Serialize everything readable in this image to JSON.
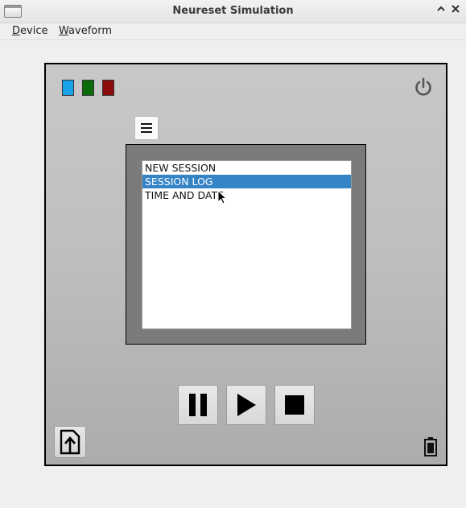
{
  "window": {
    "title": "Neureset Simulation",
    "buttons": [
      "chevron-up-icon",
      "close-icon"
    ]
  },
  "menubar": {
    "items": [
      {
        "label_u": "D",
        "label_rest": "evice"
      },
      {
        "label_u": "W",
        "label_rest": "aveform"
      }
    ]
  },
  "device": {
    "indicators": [
      {
        "name": "blue-indicator",
        "color": "#1aa3e8"
      },
      {
        "name": "green-indicator",
        "color": "#0b6b0b"
      },
      {
        "name": "red-indicator",
        "color": "#8b0a0a"
      }
    ],
    "power_icon": "power-icon",
    "menu_icon": "hamburger-menu-icon",
    "screen": {
      "items": [
        "NEW SESSION",
        "SESSION LOG",
        "TIME AND DATE"
      ],
      "selected_index": 1
    },
    "controls": [
      "pause-icon",
      "play-icon",
      "stop-icon"
    ],
    "export_icon": "upload-file-icon",
    "battery_icon": "battery-icon"
  },
  "colors": {
    "selection": "#3584c6",
    "device_border": "#000000",
    "screen_frame": "#7b7b7b"
  }
}
